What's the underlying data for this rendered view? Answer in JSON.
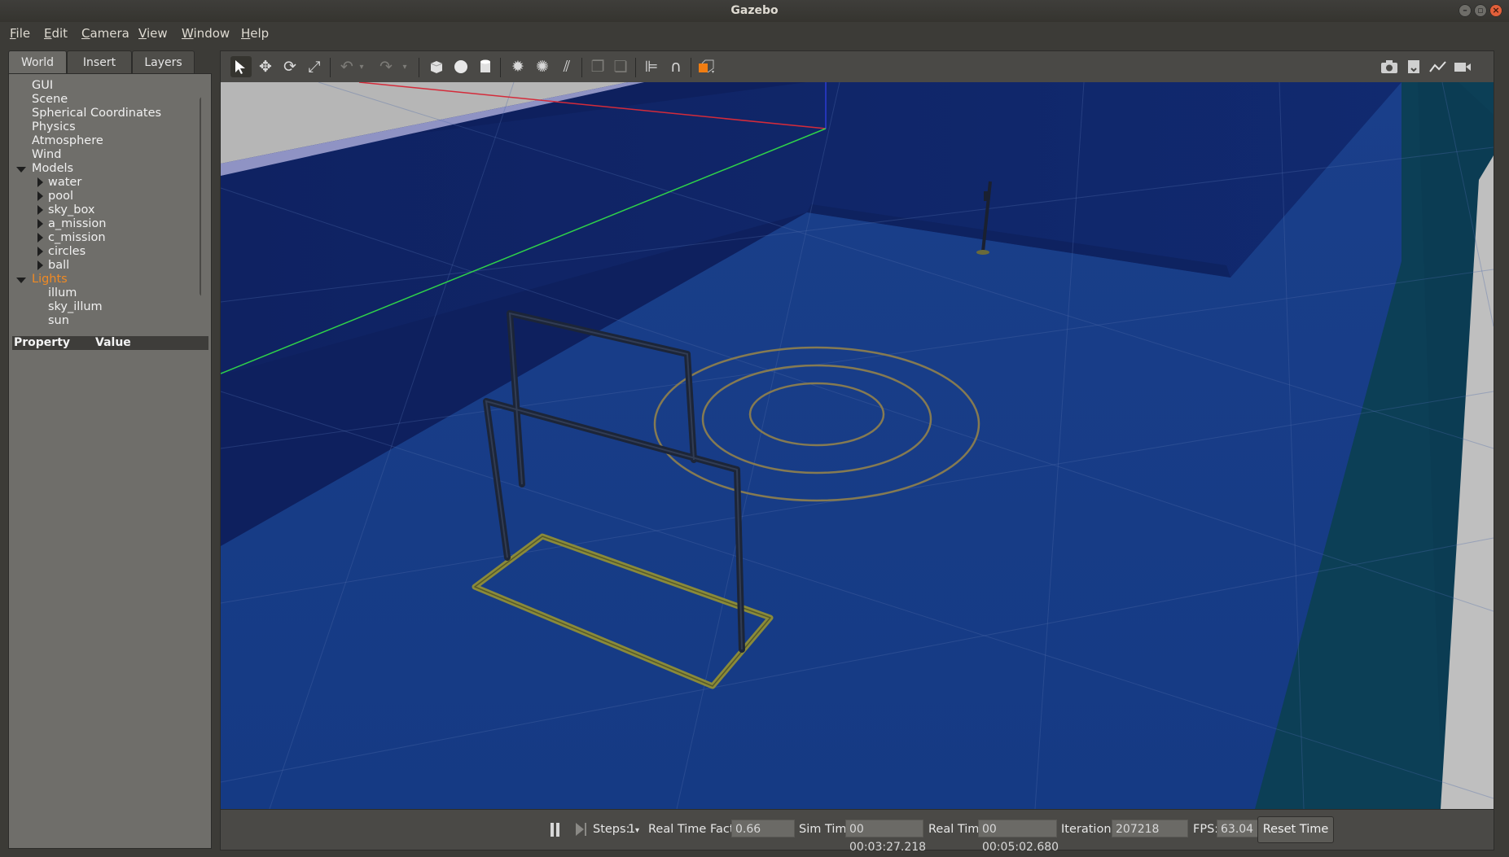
{
  "window": {
    "title": "Gazebo"
  },
  "menu": [
    {
      "label": "File",
      "mnemonic": "F",
      "rest": "ile"
    },
    {
      "label": "Edit",
      "mnemonic": "E",
      "rest": "dit"
    },
    {
      "label": "Camera",
      "mnemonic": "C",
      "rest": "amera"
    },
    {
      "label": "View",
      "mnemonic": "V",
      "rest": "iew"
    },
    {
      "label": "Window",
      "mnemonic": "W",
      "rest": "indow"
    },
    {
      "label": "Help",
      "mnemonic": "H",
      "rest": "elp"
    }
  ],
  "tabs": {
    "world": "World",
    "insert": "Insert",
    "layers": "Layers"
  },
  "tree": {
    "gui": "GUI",
    "scene": "Scene",
    "spherical": "Spherical Coordinates",
    "physics": "Physics",
    "atmosphere": "Atmosphere",
    "wind": "Wind",
    "models": "Models",
    "model_items": [
      "water",
      "pool",
      "sky_box",
      "a_mission",
      "c_mission",
      "circles",
      "ball"
    ],
    "lights": "Lights",
    "light_items": [
      "illum",
      "sky_illum",
      "sun"
    ]
  },
  "properties": {
    "col_property": "Property",
    "col_value": "Value"
  },
  "toolbar": {
    "icons": [
      "select-arrow-icon",
      "translate-icon",
      "rotate-icon",
      "scale-icon",
      "undo-icon",
      "redo-icon",
      "box-icon",
      "sphere-icon",
      "cylinder-icon",
      "point-light-icon",
      "spot-light-icon",
      "directional-light-icon",
      "copy-icon",
      "paste-icon",
      "align-icon",
      "snap-icon",
      "change-view-icon",
      "screenshot-icon",
      "log-icon",
      "plot-icon",
      "record-video-icon"
    ]
  },
  "status": {
    "steps_label": "Steps:",
    "steps_value": "1",
    "rtf_label": "Real Time Factor:",
    "rtf_value": "0.66",
    "sim_time_label": "Sim Time:",
    "sim_time_value": "00 00:03:27.218",
    "real_time_label": "Real Time:",
    "real_time_value": "00 00:05:02.680",
    "iterations_label": "Iterations:",
    "iterations_value": "207218",
    "fps_label": "FPS:",
    "fps_value": "63.04",
    "reset_label": "Reset Time"
  },
  "colors": {
    "accent_orange": "#f08a24",
    "pool_floor": "#183c86",
    "pool_wall": "#0f2464",
    "gate_frame": "#1e2a40",
    "gate_base": "#8a8a3a",
    "circle_stroke": "#7d7450"
  }
}
